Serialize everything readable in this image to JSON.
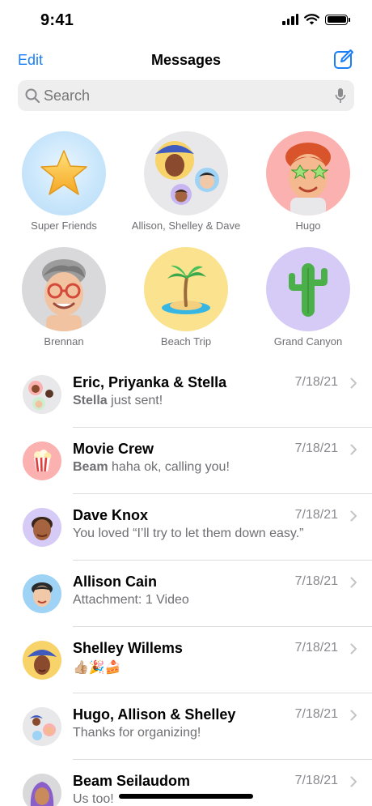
{
  "status_bar": {
    "time": "9:41",
    "icons": [
      "signal-icon",
      "wifi-icon",
      "battery-icon"
    ]
  },
  "nav": {
    "edit_label": "Edit",
    "title": "Messages",
    "compose_icon": "compose-icon"
  },
  "search": {
    "placeholder": "Search",
    "icon": "search-icon",
    "mic_icon": "mic-icon"
  },
  "pinned": [
    {
      "label": "Super Friends"
    },
    {
      "label": "Allison, Shelley & Dave"
    },
    {
      "label": "Hugo"
    },
    {
      "label": "Brennan"
    },
    {
      "label": "Beach Trip"
    },
    {
      "label": "Grand Canyon"
    }
  ],
  "conversations": [
    {
      "name": "Eric, Priyanka & Stella",
      "date": "7/18/21",
      "sender": "Stella",
      "preview": " just sent!"
    },
    {
      "name": "Movie Crew",
      "date": "7/18/21",
      "sender": "Beam",
      "preview": " haha ok, calling you!"
    },
    {
      "name": "Dave Knox",
      "date": "7/18/21",
      "sender": "",
      "preview": "You loved “I’ll try to let them down easy.”"
    },
    {
      "name": "Allison Cain",
      "date": "7/18/21",
      "sender": "",
      "preview": "Attachment: 1 Video"
    },
    {
      "name": "Shelley Willems",
      "date": "7/18/21",
      "sender": "",
      "preview": "👍🏼🎉🍰"
    },
    {
      "name": "Hugo, Allison & Shelley",
      "date": "7/18/21",
      "sender": "",
      "preview": "Thanks for organizing!"
    },
    {
      "name": "Beam Seilaudom",
      "date": "7/18/21",
      "sender": "",
      "preview": "Us too!"
    }
  ],
  "colors": {
    "accent": "#1a7ef7",
    "secondary_text": "#6e6e73",
    "search_bg": "#eeeeef"
  }
}
